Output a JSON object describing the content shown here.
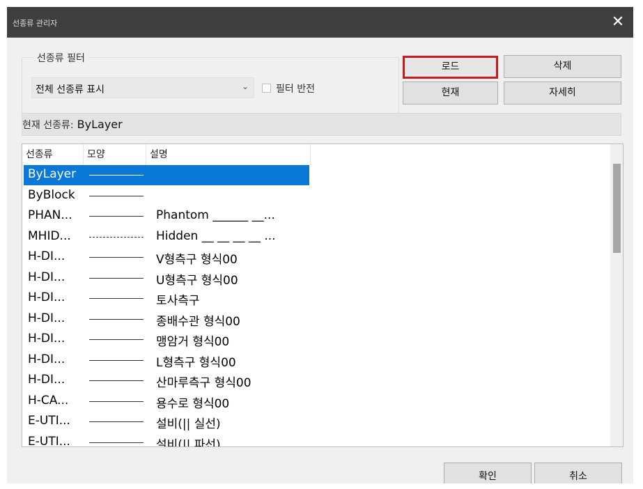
{
  "window": {
    "title": "선종류 관리자",
    "close_glyph": "✕"
  },
  "filter": {
    "legend": "선종류 필터",
    "selected_value": "전체 선종류 표시",
    "invert_label": "필터 반전",
    "invert_checked": false
  },
  "buttons": {
    "load": "로드",
    "delete": "삭제",
    "current": "현재",
    "details": "자세히",
    "ok": "확인",
    "cancel": "취소"
  },
  "current_linetype": {
    "label": "현재 선종류:",
    "value": "ByLayer"
  },
  "list": {
    "headers": [
      "선종류",
      "모양",
      "설명"
    ],
    "rows": [
      {
        "name": "ByLayer",
        "line": "solid",
        "desc": "",
        "selected": true
      },
      {
        "name": "ByBlock",
        "line": "solid",
        "desc": ""
      },
      {
        "name": "PHAN...",
        "line": "solid",
        "desc": "Phantom ______  __..."
      },
      {
        "name": "MHID...",
        "line": "dashed",
        "desc": "Hidden __ __ __ __ ..."
      },
      {
        "name": "H-DI...",
        "line": "solid",
        "desc": "V형측구 형식00"
      },
      {
        "name": "H-DI...",
        "line": "solid",
        "desc": "U형측구 형식00"
      },
      {
        "name": "H-DI...",
        "line": "solid",
        "desc": "토사측구"
      },
      {
        "name": "H-DI...",
        "line": "solid",
        "desc": "종배수관 형식00"
      },
      {
        "name": "H-DI...",
        "line": "solid",
        "desc": "맹암거 형식00"
      },
      {
        "name": "H-DI...",
        "line": "solid",
        "desc": "L형측구 형식00"
      },
      {
        "name": "H-DI...",
        "line": "solid",
        "desc": "산마루측구 형식00"
      },
      {
        "name": "H-CA...",
        "line": "solid",
        "desc": "용수로 형식00"
      },
      {
        "name": "E-UTI...",
        "line": "solid",
        "desc": "설비(|| 실선)"
      },
      {
        "name": "E-UTI...",
        "line": "solid",
        "desc": "설비(|| 파선)"
      }
    ]
  },
  "colors": {
    "selection": "#0a78d7",
    "highlight_border": "#c8191e",
    "titlebar": "#3f3f3f"
  }
}
